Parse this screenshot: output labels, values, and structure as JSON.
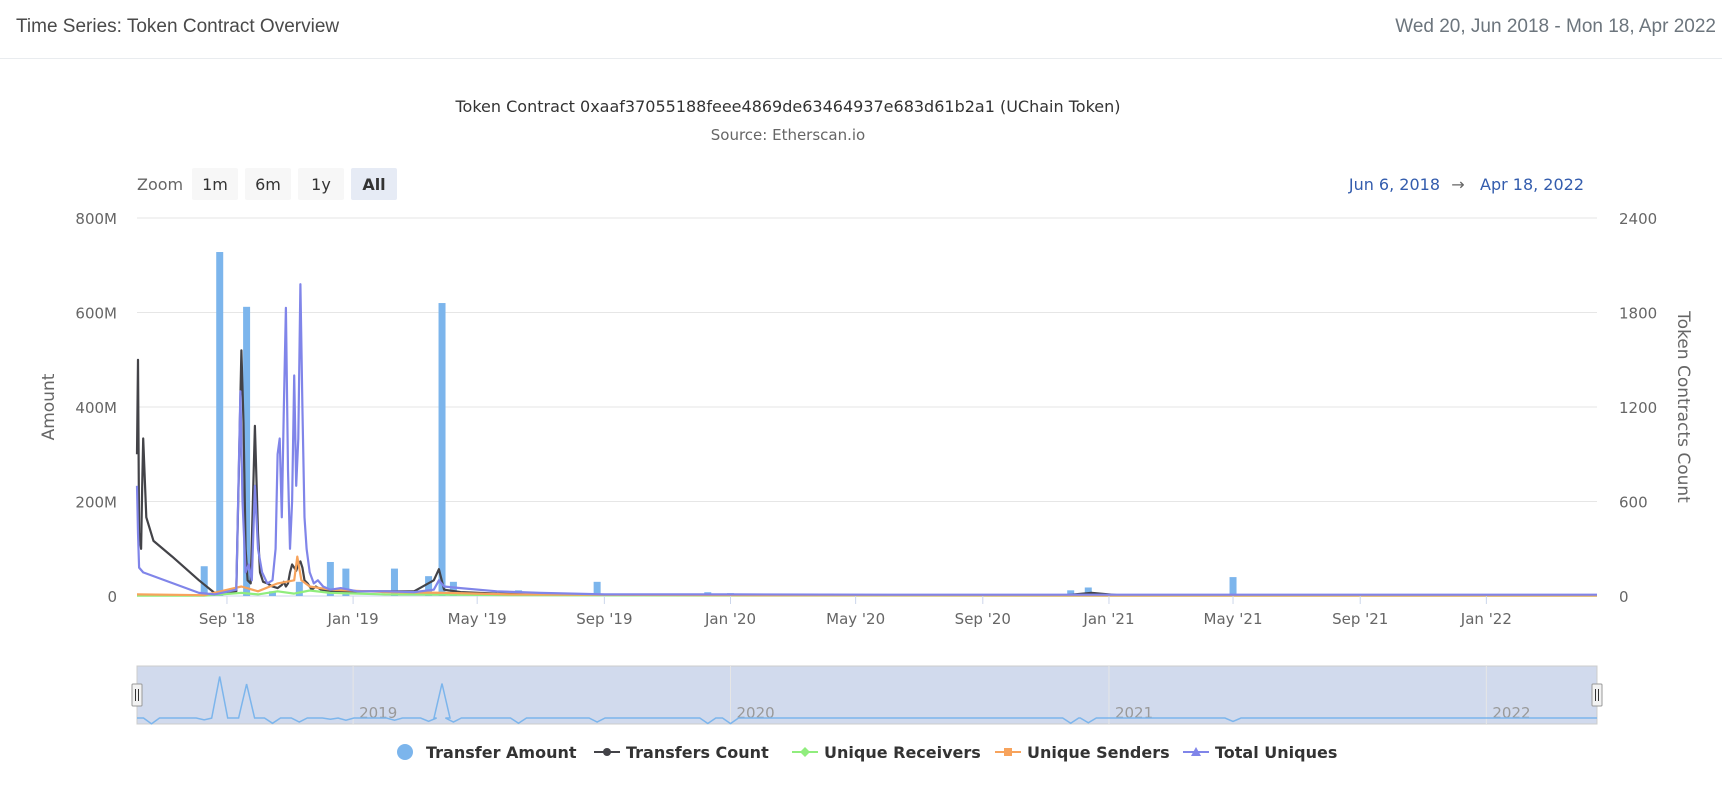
{
  "header": {
    "title": "Time Series: Token Contract Overview",
    "date_range": "Wed 20, Jun 2018 - Mon 18, Apr 2022"
  },
  "chart_data": {
    "type": "bar",
    "title": "Token Contract 0xaaf37055188feee4869de63464937e683d61b2a1 (UChain Token)",
    "subtitle": "Source: Etherscan.io",
    "zoom": {
      "label": "Zoom",
      "buttons": [
        "1m",
        "6m",
        "1y",
        "All"
      ],
      "selected": "All"
    },
    "range_selector": {
      "from": "Jun 6, 2018",
      "arrow": "→",
      "to": "Apr 18, 2022"
    },
    "x_axis": {
      "type": "datetime",
      "range": [
        "2018-06-06",
        "2022-04-18"
      ],
      "ticks": [
        {
          "date": "2018-09-01",
          "label": "Sep '18"
        },
        {
          "date": "2019-01-01",
          "label": "Jan '19"
        },
        {
          "date": "2019-05-01",
          "label": "May '19"
        },
        {
          "date": "2019-09-01",
          "label": "Sep '19"
        },
        {
          "date": "2020-01-01",
          "label": "Jan '20"
        },
        {
          "date": "2020-05-01",
          "label": "May '20"
        },
        {
          "date": "2020-09-01",
          "label": "Sep '20"
        },
        {
          "date": "2021-01-01",
          "label": "Jan '21"
        },
        {
          "date": "2021-05-01",
          "label": "May '21"
        },
        {
          "date": "2021-09-01",
          "label": "Sep '21"
        },
        {
          "date": "2022-01-01",
          "label": "Jan '22"
        }
      ]
    },
    "y_axis_left": {
      "label": "Amount",
      "range": [
        0,
        800000000
      ],
      "ticks": [
        {
          "value": 0,
          "label": "0"
        },
        {
          "value": 200000000,
          "label": "200M"
        },
        {
          "value": 400000000,
          "label": "400M"
        },
        {
          "value": 600000000,
          "label": "600M"
        },
        {
          "value": 800000000,
          "label": "800M"
        }
      ]
    },
    "y_axis_right": {
      "label": "Token Contracts Count",
      "range": [
        0,
        2400
      ],
      "ticks": [
        {
          "value": 0,
          "label": "0"
        },
        {
          "value": 600,
          "label": "600"
        },
        {
          "value": 1200,
          "label": "1200"
        },
        {
          "value": 1800,
          "label": "1800"
        },
        {
          "value": 2400,
          "label": "2400"
        }
      ]
    },
    "grid": true,
    "legend_position": "bottom-center",
    "series": [
      {
        "name": "Transfer Amount",
        "type": "column",
        "axis": "left",
        "color": "#7cb5ec",
        "x": [
          "2018-06-20",
          "2018-08-10",
          "2018-08-25",
          "2018-09-20",
          "2018-10-15",
          "2018-11-10",
          "2018-12-10",
          "2018-12-25",
          "2019-02-10",
          "2019-03-15",
          "2019-03-28",
          "2019-04-08",
          "2019-06-10",
          "2019-08-25",
          "2019-12-10",
          "2020-01-01",
          "2020-11-25",
          "2020-12-12",
          "2021-05-01"
        ],
        "values": [
          3000000,
          63000000,
          728000000,
          612000000,
          10000000,
          30000000,
          72000000,
          58000000,
          58000000,
          42000000,
          620000000,
          30000000,
          12000000,
          30000000,
          8000000,
          6000000,
          12000000,
          18000000,
          40000000
        ]
      },
      {
        "name": "Transfers Count",
        "type": "line",
        "axis": "right",
        "color": "#434348",
        "x": [
          "2018-06-06",
          "2018-06-07",
          "2018-06-08",
          "2018-06-10",
          "2018-06-11",
          "2018-06-12",
          "2018-06-15",
          "2018-06-22",
          "2018-07-10",
          "2018-08-05",
          "2018-08-20",
          "2018-09-10",
          "2018-09-15",
          "2018-09-17",
          "2018-09-19",
          "2018-09-21",
          "2018-09-24",
          "2018-09-28",
          "2018-10-01",
          "2018-10-03",
          "2018-10-06",
          "2018-10-10",
          "2018-10-15",
          "2018-10-20",
          "2018-10-24",
          "2018-10-26",
          "2018-10-28",
          "2018-10-30",
          "2018-11-01",
          "2018-11-03",
          "2018-11-05",
          "2018-11-07",
          "2018-11-09",
          "2018-11-11",
          "2018-11-13",
          "2018-11-15",
          "2018-11-18",
          "2018-11-22",
          "2018-11-26",
          "2018-12-01",
          "2018-12-10",
          "2018-12-20",
          "2019-01-05",
          "2019-02-01",
          "2019-03-01",
          "2019-03-20",
          "2019-03-25",
          "2019-03-30",
          "2019-04-15",
          "2019-05-20",
          "2019-07-01",
          "2019-09-01",
          "2020-01-01",
          "2020-06-01",
          "2020-11-20",
          "2020-12-15",
          "2021-01-10",
          "2021-06-01",
          "2022-01-01",
          "2022-04-18"
        ],
        "values": [
          900,
          1500,
          400,
          300,
          700,
          1000,
          500,
          350,
          250,
          100,
          20,
          30,
          1560,
          1100,
          300,
          100,
          80,
          1080,
          400,
          150,
          90,
          80,
          60,
          50,
          70,
          90,
          60,
          80,
          150,
          200,
          180,
          160,
          200,
          220,
          180,
          100,
          80,
          40,
          60,
          40,
          30,
          30,
          30,
          30,
          30,
          100,
          170,
          40,
          25,
          15,
          10,
          8,
          5,
          5,
          5,
          20,
          5,
          5,
          5,
          5
        ]
      },
      {
        "name": "Unique Receivers",
        "type": "line",
        "axis": "right",
        "color": "#90ed7d",
        "x": [
          "2018-06-06",
          "2018-08-10",
          "2018-09-15",
          "2018-10-01",
          "2018-10-20",
          "2018-11-05",
          "2018-11-20",
          "2018-12-10",
          "2019-02-01",
          "2019-04-01",
          "2019-06-01",
          "2020-01-01",
          "2021-01-01",
          "2022-04-18"
        ],
        "values": [
          2,
          2,
          20,
          10,
          30,
          15,
          35,
          20,
          10,
          8,
          5,
          3,
          2,
          2
        ]
      },
      {
        "name": "Unique Senders",
        "type": "line",
        "axis": "right",
        "color": "#f7a35c",
        "x": [
          "2018-06-06",
          "2018-08-10",
          "2018-09-15",
          "2018-10-01",
          "2018-10-20",
          "2018-11-05",
          "2018-11-08",
          "2018-11-12",
          "2018-11-20",
          "2018-12-10",
          "2019-02-01",
          "2019-04-01",
          "2019-06-01",
          "2020-01-01",
          "2021-01-01",
          "2022-04-18"
        ],
        "values": [
          10,
          5,
          60,
          30,
          80,
          100,
          250,
          100,
          60,
          40,
          25,
          20,
          10,
          5,
          3,
          3
        ]
      },
      {
        "name": "Total Uniques",
        "type": "line",
        "axis": "right",
        "color": "#8085e9",
        "x": [
          "2018-06-06",
          "2018-06-07",
          "2018-06-08",
          "2018-06-12",
          "2018-08-05",
          "2018-08-20",
          "2018-09-10",
          "2018-09-14",
          "2018-09-16",
          "2018-09-19",
          "2018-09-22",
          "2018-09-25",
          "2018-09-28",
          "2018-10-01",
          "2018-10-05",
          "2018-10-10",
          "2018-10-15",
          "2018-10-18",
          "2018-10-20",
          "2018-10-22",
          "2018-10-24",
          "2018-10-26",
          "2018-10-28",
          "2018-10-30",
          "2018-11-01",
          "2018-11-03",
          "2018-11-05",
          "2018-11-07",
          "2018-11-09",
          "2018-11-11",
          "2018-11-13",
          "2018-11-15",
          "2018-11-17",
          "2018-11-20",
          "2018-11-24",
          "2018-11-28",
          "2018-12-03",
          "2018-12-10",
          "2018-12-20",
          "2019-01-05",
          "2019-02-01",
          "2019-03-01",
          "2019-03-20",
          "2019-03-25",
          "2019-03-30",
          "2019-04-15",
          "2019-05-20",
          "2019-07-01",
          "2019-09-01",
          "2020-01-01",
          "2020-06-01",
          "2020-12-15",
          "2021-06-01",
          "2022-04-18"
        ],
        "values": [
          700,
          400,
          180,
          150,
          20,
          10,
          40,
          1300,
          600,
          150,
          200,
          100,
          700,
          300,
          150,
          80,
          100,
          300,
          900,
          1000,
          500,
          1180,
          1830,
          800,
          300,
          600,
          1400,
          700,
          1000,
          1980,
          1200,
          500,
          300,
          150,
          80,
          100,
          60,
          40,
          50,
          30,
          30,
          25,
          40,
          100,
          60,
          50,
          30,
          20,
          10,
          10,
          8,
          8,
          8,
          8
        ]
      }
    ],
    "navigator": {
      "year_labels": [
        {
          "date": "2019-01-01",
          "label": "2019"
        },
        {
          "date": "2020-01-01",
          "label": "2020"
        },
        {
          "date": "2021-01-01",
          "label": "2021"
        },
        {
          "date": "2022-01-01",
          "label": "2022"
        }
      ]
    }
  }
}
